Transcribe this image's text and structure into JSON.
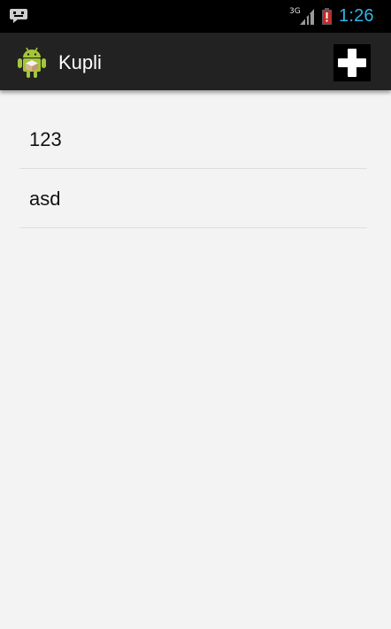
{
  "status_bar": {
    "network_type": "3G",
    "time": "1:26",
    "notification_icon": "messaging-icon",
    "signal_icon": "cell-signal-icon",
    "battery_icon": "battery-low-icon",
    "clock_color": "#33b5e5"
  },
  "action_bar": {
    "title": "Kupli",
    "app_icon": "android-icon",
    "add_icon": "plus-icon"
  },
  "list": {
    "items": [
      {
        "label": "123"
      },
      {
        "label": "asd"
      }
    ]
  }
}
